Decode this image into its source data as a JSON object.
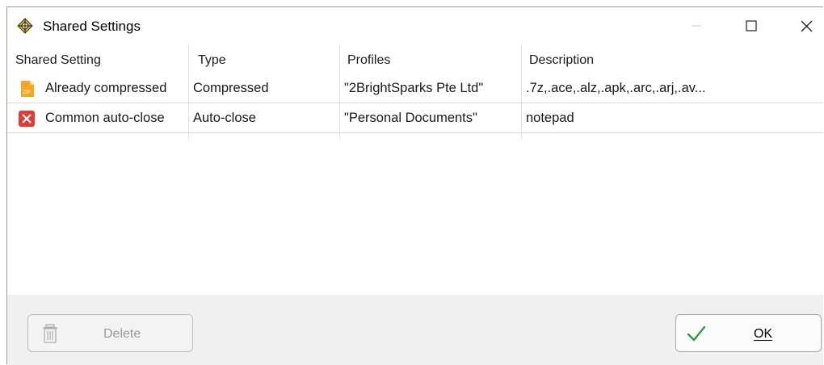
{
  "window": {
    "title": "Shared Settings",
    "controls": {
      "minimize": "minimize",
      "maximize": "maximize",
      "close": "close"
    }
  },
  "table": {
    "headers": [
      "Shared Setting",
      "Type",
      "Profiles",
      "Description"
    ],
    "rows": [
      {
        "icon": "zip-file-icon",
        "name": "Already compressed",
        "type": "Compressed",
        "profiles": "\"2BrightSparks Pte Ltd\"",
        "description": ".7z,.ace,.alz,.apk,.arc,.arj,.av..."
      },
      {
        "icon": "red-x-icon",
        "name": "Common auto-close",
        "type": "Auto-close",
        "profiles": "\"Personal Documents\"",
        "description": "notepad"
      }
    ]
  },
  "buttons": {
    "delete": {
      "label": "Delete",
      "icon": "trash-icon",
      "enabled": false
    },
    "ok": {
      "label": "OK",
      "icon": "checkmark-icon",
      "mnemonic": "O"
    }
  },
  "colors": {
    "zip_icon": "#f5a623",
    "close_icon_bg": "#e53935",
    "check_icon": "#2e9b46"
  }
}
